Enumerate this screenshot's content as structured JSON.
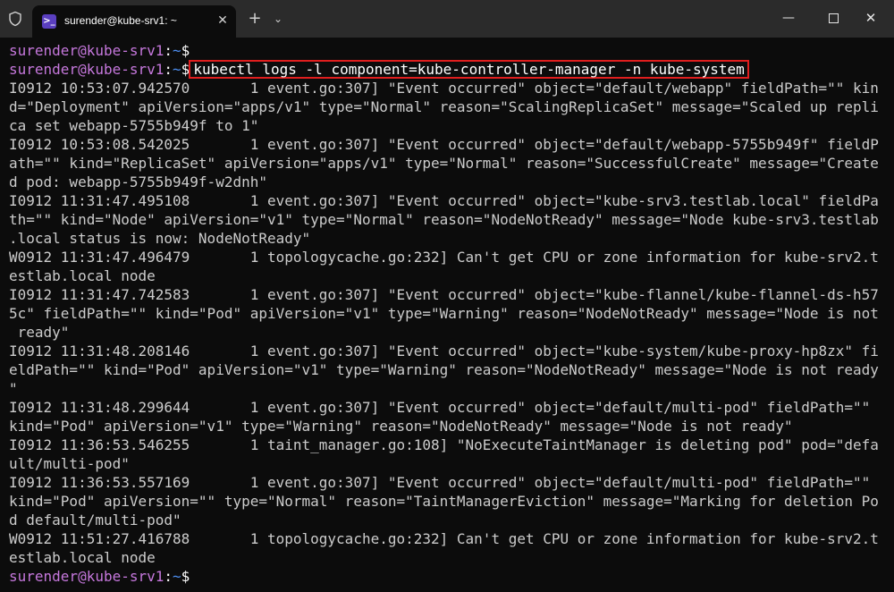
{
  "tab": {
    "title": "surender@kube-srv1: ~",
    "icon_glyph": ">_",
    "close_glyph": "✕"
  },
  "toolbar": {
    "new_tab_glyph": "+",
    "dropdown_glyph": "⌄"
  },
  "window_controls": {
    "minimize_glyph": "—",
    "close_glyph": "✕"
  },
  "prompt": {
    "user_host": "surender@kube-srv1",
    "separator": ":",
    "path": "~",
    "symbol": "$"
  },
  "command": "kubectl logs -l component=kube-controller-manager -n kube-system",
  "output_lines": [
    "I0912 10:53:07.942570       1 event.go:307] \"Event occurred\" object=\"default/webapp\" fieldPath=\"\" kin",
    "d=\"Deployment\" apiVersion=\"apps/v1\" type=\"Normal\" reason=\"ScalingReplicaSet\" message=\"Scaled up repli",
    "ca set webapp-5755b949f to 1\"",
    "I0912 10:53:08.542025       1 event.go:307] \"Event occurred\" object=\"default/webapp-5755b949f\" fieldP",
    "ath=\"\" kind=\"ReplicaSet\" apiVersion=\"apps/v1\" type=\"Normal\" reason=\"SuccessfulCreate\" message=\"Create",
    "d pod: webapp-5755b949f-w2dnh\"",
    "I0912 11:31:47.495108       1 event.go:307] \"Event occurred\" object=\"kube-srv3.testlab.local\" fieldPa",
    "th=\"\" kind=\"Node\" apiVersion=\"v1\" type=\"Normal\" reason=\"NodeNotReady\" message=\"Node kube-srv3.testlab",
    ".local status is now: NodeNotReady\"",
    "W0912 11:31:47.496479       1 topologycache.go:232] Can't get CPU or zone information for kube-srv2.t",
    "estlab.local node",
    "I0912 11:31:47.742583       1 event.go:307] \"Event occurred\" object=\"kube-flannel/kube-flannel-ds-h57",
    "5c\" fieldPath=\"\" kind=\"Pod\" apiVersion=\"v1\" type=\"Warning\" reason=\"NodeNotReady\" message=\"Node is not",
    " ready\"",
    "I0912 11:31:48.208146       1 event.go:307] \"Event occurred\" object=\"kube-system/kube-proxy-hp8zx\" fi",
    "eldPath=\"\" kind=\"Pod\" apiVersion=\"v1\" type=\"Warning\" reason=\"NodeNotReady\" message=\"Node is not ready",
    "\"",
    "I0912 11:31:48.299644       1 event.go:307] \"Event occurred\" object=\"default/multi-pod\" fieldPath=\"\"",
    "kind=\"Pod\" apiVersion=\"v1\" type=\"Warning\" reason=\"NodeNotReady\" message=\"Node is not ready\"",
    "I0912 11:36:53.546255       1 taint_manager.go:108] \"NoExecuteTaintManager is deleting pod\" pod=\"defa",
    "ult/multi-pod\"",
    "I0912 11:36:53.557169       1 event.go:307] \"Event occurred\" object=\"default/multi-pod\" fieldPath=\"\"",
    "kind=\"Pod\" apiVersion=\"\" type=\"Normal\" reason=\"TaintManagerEviction\" message=\"Marking for deletion Po",
    "d default/multi-pod\"",
    "W0912 11:51:27.416788       1 topologycache.go:232] Can't get CPU or zone information for kube-srv2.t",
    "estlab.local node"
  ],
  "colors": {
    "background": "#0c0c0c",
    "titlebar": "#2b2b2b",
    "prompt_user": "#c678dd",
    "prompt_path": "#4d8ef0",
    "text": "#cccccc",
    "highlight_border": "#e01e1e"
  }
}
